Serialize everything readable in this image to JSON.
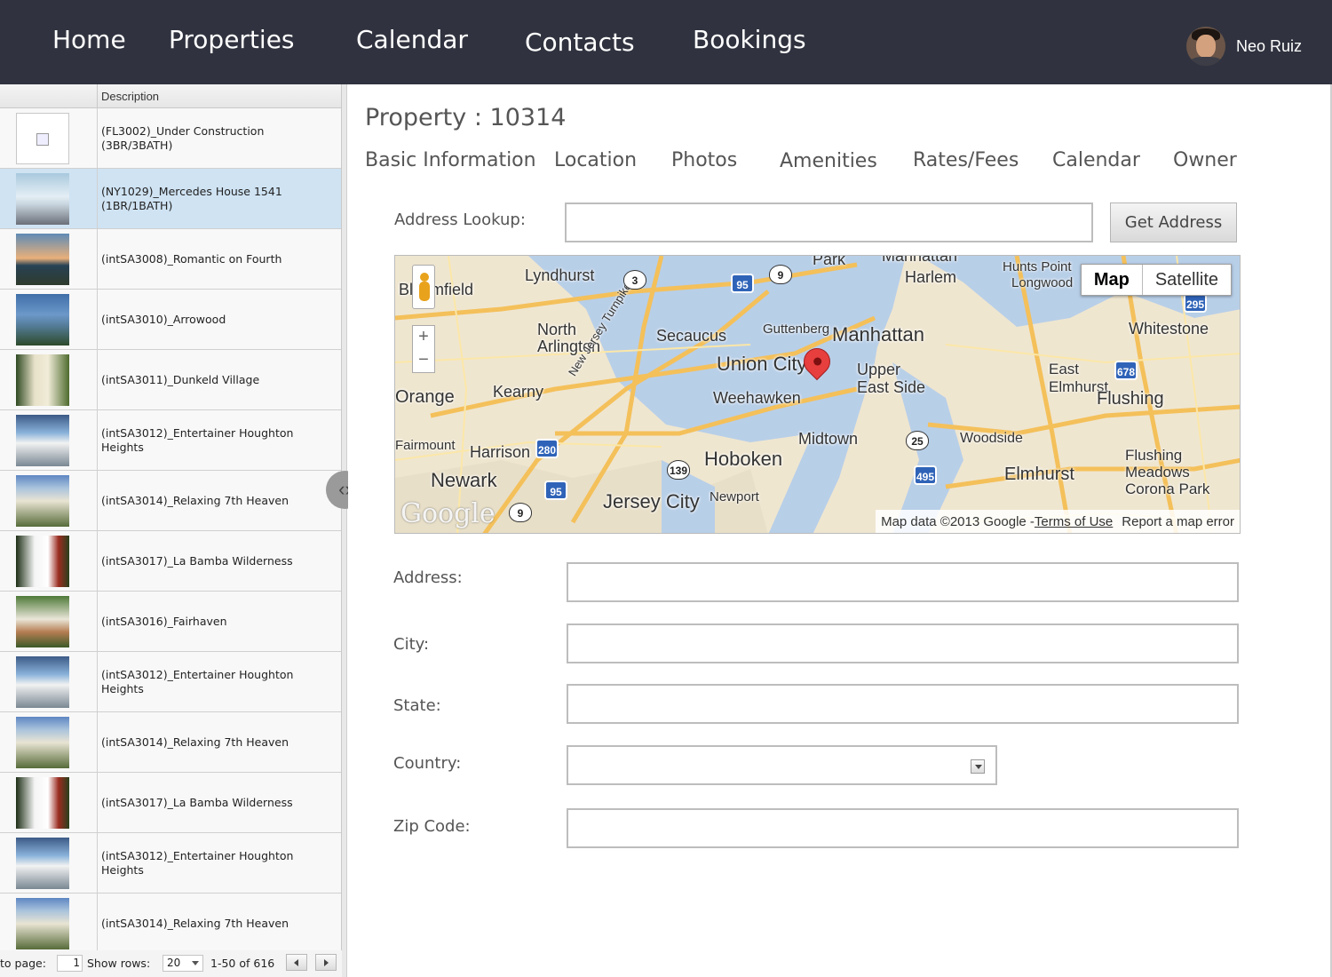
{
  "nav": {
    "items": [
      "Home",
      "Properties",
      "Calendar",
      "Contacts",
      "Bookings"
    ],
    "user_name": "Neo Ruiz"
  },
  "list": {
    "header_description": "Description",
    "rows": [
      {
        "desc": "(FL3002)_Under Construction (3BR/3BATH)",
        "thumb": "none"
      },
      {
        "desc": "(NY1029)_Mercedes House 1541 (1BR/1BATH)",
        "thumb": "bedroom"
      },
      {
        "desc": "(intSA3008)_Romantic on Fourth",
        "thumb": "sunset"
      },
      {
        "desc": "(intSA3010)_Arrowood",
        "thumb": "arrowood"
      },
      {
        "desc": "(intSA3011)_Dunkeld Village",
        "thumb": "dunkeld"
      },
      {
        "desc": "(intSA3012)_Entertainer Houghton Heights",
        "thumb": "terrace"
      },
      {
        "desc": "(intSA3014)_Relaxing 7th Heaven",
        "thumb": "heaven"
      },
      {
        "desc": "(intSA3017)_La Bamba Wilderness",
        "thumb": "bamba"
      },
      {
        "desc": "(intSA3016)_Fairhaven",
        "thumb": "fairhaven"
      },
      {
        "desc": "(intSA3012)_Entertainer Houghton Heights",
        "thumb": "terrace"
      },
      {
        "desc": "(intSA3014)_Relaxing 7th Heaven",
        "thumb": "heaven"
      },
      {
        "desc": "(intSA3017)_La Bamba Wilderness",
        "thumb": "bamba"
      },
      {
        "desc": "(intSA3012)_Entertainer Houghton Heights",
        "thumb": "terrace"
      },
      {
        "desc": "(intSA3014)_Relaxing 7th Heaven",
        "thumb": "heaven"
      }
    ],
    "selected_index": 1
  },
  "pager": {
    "goto_label": "to page:",
    "page_value": "1",
    "show_rows_label": "Show rows:",
    "rows_value": "20",
    "range_text": "1-50 of 616"
  },
  "main": {
    "title": "Property : 10314",
    "tabs": [
      "Basic Information",
      "Location",
      "Photos",
      "Amenities",
      "Rates/Fees",
      "Calendar",
      "Owner"
    ],
    "address_lookup_label": "Address Lookup:",
    "get_address_button": "Get Address",
    "fields": {
      "address": "Address:",
      "city": "City:",
      "state": "State:",
      "country": "Country:",
      "zip": "Zip Code:"
    }
  },
  "map": {
    "type_map": "Map",
    "type_satellite": "Satellite",
    "footer_data": "Map data ©2013 Google - ",
    "footer_terms": "Terms of Use",
    "footer_report": "Report a map error",
    "logo": "Google",
    "labels": [
      "Park",
      "Manhattan",
      "Harlem",
      "Hunts Point",
      "Longwood",
      "Bloomfield",
      "Lyndhurst",
      "Secaucus",
      "North Arlington",
      "Guttenberg",
      "Manhattan",
      "Union City",
      "Upper East Side",
      "East Elmhurst",
      "Whitestone",
      "Flushing",
      "Kearny",
      "Orange",
      "Weehawken",
      "Midtown",
      "Woodside",
      "Harrison",
      "Hoboken",
      "Elmhurst",
      "Flushing Meadows Corona Park",
      "Newark",
      "Jersey City",
      "Newport",
      "New Jersey Turnpike",
      "Fairmount"
    ],
    "shields": [
      "3",
      "95",
      "9",
      "295",
      "678",
      "280",
      "25",
      "495",
      "139",
      "95",
      "9"
    ]
  },
  "colors": {
    "topbar": "#30333f",
    "selected_row": "#cfe3f3",
    "map_water": "#b8cfe8",
    "map_land": "#efe6d0",
    "pin": "#e73e3e"
  }
}
